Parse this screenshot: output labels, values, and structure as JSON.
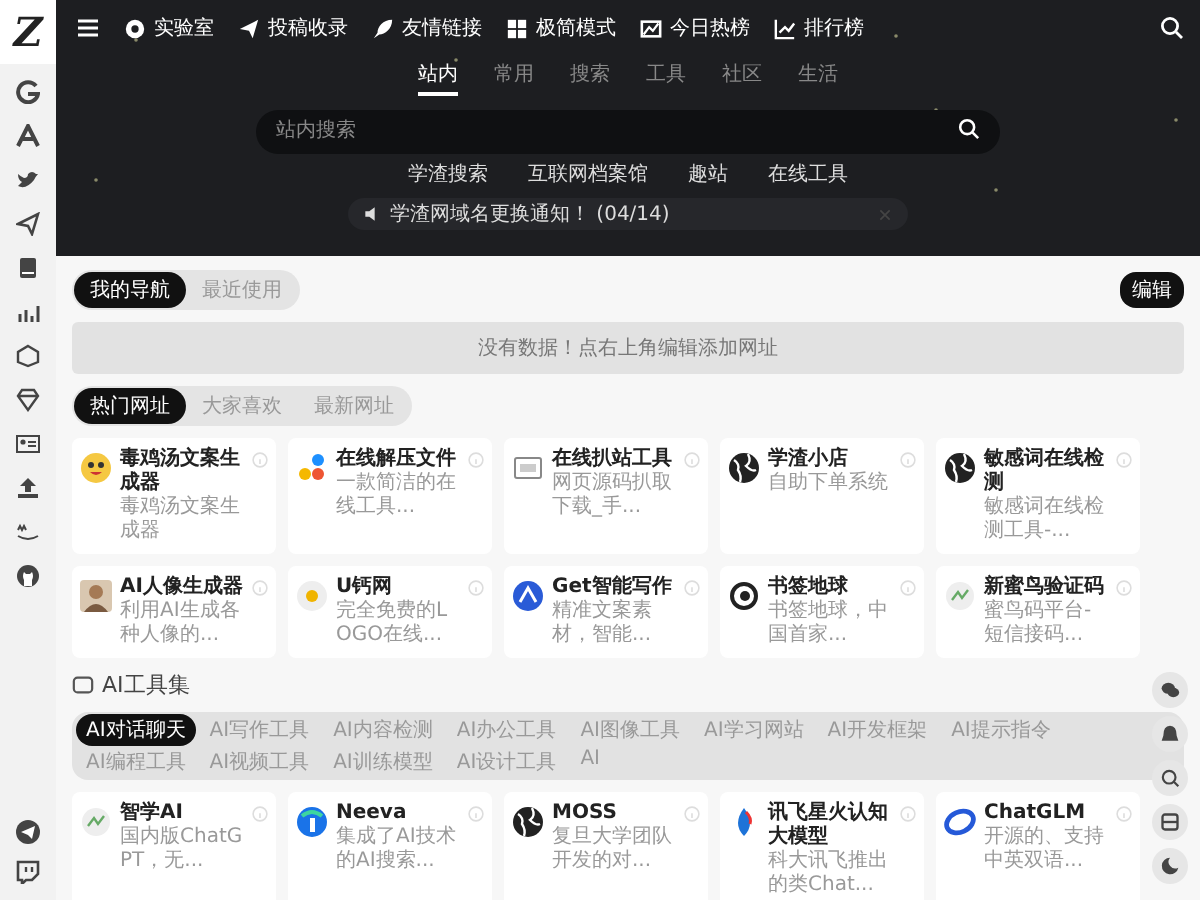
{
  "logo": "Z",
  "top_nav": {
    "items": [
      {
        "label": "实验室"
      },
      {
        "label": "投稿收录"
      },
      {
        "label": "友情链接"
      },
      {
        "label": "极简模式"
      },
      {
        "label": "今日热榜"
      },
      {
        "label": "排行榜"
      }
    ]
  },
  "search": {
    "tabs": [
      {
        "label": "站内",
        "selected": true
      },
      {
        "label": "常用",
        "selected": false
      },
      {
        "label": "搜索",
        "selected": false
      },
      {
        "label": "工具",
        "selected": false
      },
      {
        "label": "社区",
        "selected": false
      },
      {
        "label": "生活",
        "selected": false
      }
    ],
    "placeholder": "站内搜索",
    "hot_links": [
      "学渣搜索",
      "互联网档案馆",
      "趣站",
      "在线工具"
    ],
    "notice": "学渣网域名更换通知！ (04/14)"
  },
  "my_nav": {
    "tabs": [
      {
        "label": "我的导航",
        "selected": true
      },
      {
        "label": "最近使用",
        "selected": false
      }
    ],
    "edit_button": "编辑",
    "empty_message": "没有数据！点右上角编辑添加网址"
  },
  "hot_sites": {
    "tabs": [
      {
        "label": "热门网址",
        "selected": true
      },
      {
        "label": "大家喜欢",
        "selected": false
      },
      {
        "label": "最新网址",
        "selected": false
      }
    ],
    "cards": [
      {
        "title": "毒鸡汤文案生成器",
        "desc": "毒鸡汤文案生成器"
      },
      {
        "title": "在线解压文件",
        "desc": "一款简洁的在线工具..."
      },
      {
        "title": "在线扒站工具",
        "desc": "网页源码扒取下载_手..."
      },
      {
        "title": "学渣小店",
        "desc": "自助下单系统"
      },
      {
        "title": "敏感词在线检测",
        "desc": "敏感词在线检测工具-..."
      },
      {
        "title": "AI人像生成器",
        "desc": "利用AI生成各种人像的..."
      },
      {
        "title": "U钙网",
        "desc": "完全免费的LOGO在线..."
      },
      {
        "title": "Get智能写作",
        "desc": "精准文案素材，智能..."
      },
      {
        "title": "书签地球",
        "desc": "书签地球，中国首家..."
      },
      {
        "title": "新蜜鸟验证码",
        "desc": "蜜鸟码平台-短信接码..."
      }
    ]
  },
  "ai_tools": {
    "title": "AI工具集",
    "tabs": [
      {
        "label": "AI对话聊天",
        "selected": true
      },
      {
        "label": "AI写作工具",
        "selected": false
      },
      {
        "label": "AI内容检测",
        "selected": false
      },
      {
        "label": "AI办公工具",
        "selected": false
      },
      {
        "label": "AI图像工具",
        "selected": false
      },
      {
        "label": "AI学习网站",
        "selected": false
      },
      {
        "label": "AI开发框架",
        "selected": false
      },
      {
        "label": "AI提示指令",
        "selected": false
      },
      {
        "label": "AI编程工具",
        "selected": false
      },
      {
        "label": "AI视频工具",
        "selected": false
      },
      {
        "label": "AI训练模型",
        "selected": false
      },
      {
        "label": "AI设计工具",
        "selected": false
      },
      {
        "label": "AI",
        "selected": false
      }
    ],
    "cards": [
      {
        "title": "智学AI",
        "desc": "国内版ChatGPT，无..."
      },
      {
        "title": "Neeva",
        "desc": "集成了AI技术的AI搜索..."
      },
      {
        "title": "MOSS",
        "desc": "复旦大学团队开发的对..."
      },
      {
        "title": "讯飞星火认知大模型",
        "desc": "科大讯飞推出的类Chat..."
      },
      {
        "title": "ChatGLM",
        "desc": "开源的、支持中英双语..."
      }
    ]
  }
}
